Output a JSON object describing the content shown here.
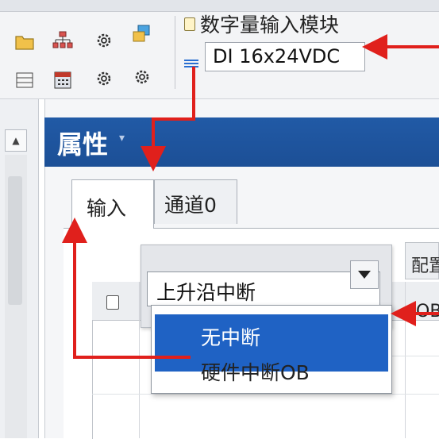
{
  "toolbar": {
    "module_title": "数字量输入模块",
    "order_number": "DI 16x24VDC",
    "icons": [
      "folder-icon",
      "network-icon",
      "gear-icon",
      "copy-icon",
      "list-icon",
      "device-icon",
      "gear-icon",
      "gear-icon"
    ]
  },
  "properties": {
    "title": "属性",
    "tabs": [
      {
        "label": "输入",
        "active": true
      },
      {
        "label": "通道0",
        "active": false
      }
    ],
    "table": {
      "config_header": "配置",
      "cell_value": "OB"
    },
    "event_select": {
      "value": "上升沿中断",
      "options": [
        {
          "label": "无中断",
          "highlighted": true
        },
        {
          "label": "硬件中断OB",
          "highlighted": false
        }
      ]
    }
  },
  "colors": {
    "header_blue": "#1f5aa6",
    "highlight_blue": "#1f62c4",
    "annotation_red": "#e0201c"
  }
}
